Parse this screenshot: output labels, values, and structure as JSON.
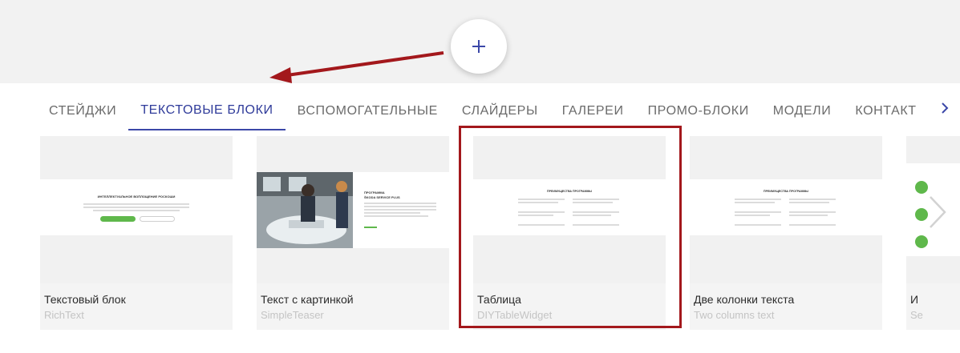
{
  "add_button": {
    "icon": "plus-icon",
    "color": "#3b47a8"
  },
  "tabs": [
    {
      "label": "СТЕЙДЖИ",
      "active": false
    },
    {
      "label": "ТЕКСТОВЫЕ БЛОКИ",
      "active": true
    },
    {
      "label": "ВСПОМОГАТЕЛЬНЫЕ",
      "active": false
    },
    {
      "label": "СЛАЙДЕРЫ",
      "active": false
    },
    {
      "label": "ГАЛЕРЕИ",
      "active": false
    },
    {
      "label": "ПРОМО-БЛОКИ",
      "active": false
    },
    {
      "label": "МОДЕЛИ",
      "active": false
    },
    {
      "label": "КОНТАКТ",
      "active": false
    }
  ],
  "cards": [
    {
      "title": "Текстовый блок",
      "subtitle": "RichText",
      "preview_heading": "ИНТЕЛЛЕКТУАЛЬНОЕ ВОПЛОЩЕНИЕ РОСКОШИ"
    },
    {
      "title": "Текст с картинкой",
      "subtitle": "SimpleTeaser",
      "preview_heading": "ПРОГРАММА",
      "preview_subheading": "ŠKODA SERVICE PLUS"
    },
    {
      "title": "Таблица",
      "subtitle": "DIYTableWidget",
      "preview_heading": "ПРЕИМУЩЕСТВА ПРОГРАММЫ"
    },
    {
      "title": "Две колонки текста",
      "subtitle": "Two columns text",
      "preview_heading": "ПРЕИМУЩЕСТВА ПРОГРАММЫ"
    },
    {
      "title": "И",
      "subtitle": "Se"
    }
  ],
  "colors": {
    "accent": "#3b47a8",
    "annotation": "#a3181c",
    "brand_green": "#5fb84b"
  }
}
